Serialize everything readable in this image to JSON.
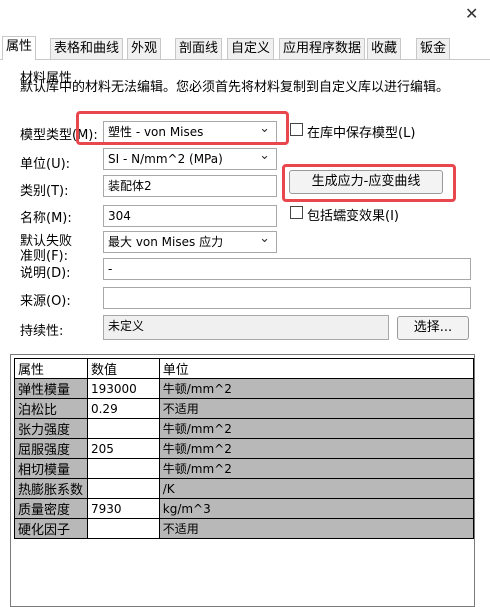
{
  "window": {
    "close_glyph": "✕"
  },
  "tabs": [
    "属性",
    "表格和曲线",
    "外观",
    "剖面线",
    "自定义",
    "应用程序数据",
    "收藏",
    "钣金"
  ],
  "material": {
    "group_label": "材料属性",
    "notice": "默认库中的材料无法编辑。您必须首先将材料复制到自定义库以进行编辑。",
    "model_type_label": "模型类型(M):",
    "model_type_value": "塑性 - von Mises",
    "save_model_label": "在库中保存模型(L)",
    "units_label": "单位(U):",
    "units_value": "SI - N/mm^2 (MPa)",
    "category_label": "类别(T):",
    "category_value": "装配体2",
    "generate_button": "生成应力-应变曲线",
    "name_label": "名称(M):",
    "name_value": "304",
    "creep_label": "包括蠕变效果(I)",
    "failure_label_1": "默认失败",
    "failure_label_2": "准则(F):",
    "failure_value": "最大 von Mises 应力",
    "description_label": "说明(D):",
    "description_value": "-",
    "source_label": "来源(O):",
    "source_value": "",
    "sustain_label": "持续性:",
    "sustain_value": "未定义",
    "select_button": "选择..."
  },
  "properties_table": {
    "headers": [
      "属性",
      "数值",
      "单位"
    ],
    "rows": [
      {
        "name": "弹性模量",
        "value": "193000",
        "unit": "牛顿/mm^2"
      },
      {
        "name": "泊松比",
        "value": "0.29",
        "unit": "不适用"
      },
      {
        "name": "张力强度",
        "value": "",
        "unit": "牛顿/mm^2"
      },
      {
        "name": "屈服强度",
        "value": "205",
        "unit": "牛顿/mm^2"
      },
      {
        "name": "相切模量",
        "value": "",
        "unit": "牛顿/mm^2"
      },
      {
        "name": "热膨胀系数",
        "value": "",
        "unit": "/K"
      },
      {
        "name": "质量密度",
        "value": "7930",
        "unit": "kg/m^3"
      },
      {
        "name": "硬化因子",
        "value": "",
        "unit": "不适用"
      }
    ]
  },
  "colors": {
    "highlight": "#e8474d",
    "grid_gray": "#b8b8b8"
  }
}
